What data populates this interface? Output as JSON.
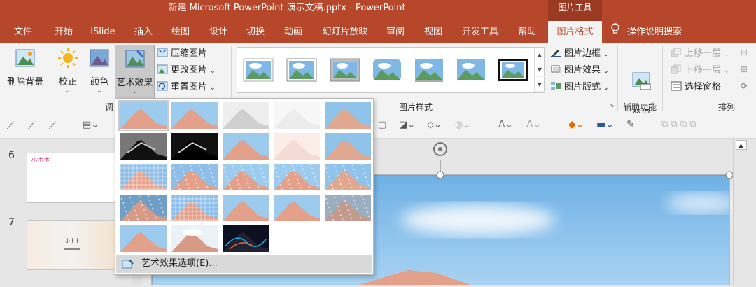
{
  "window": {
    "title": "新建 Microsoft PowerPoint 演示文稿.pptx  -  PowerPoint",
    "context_tab": "图片工具"
  },
  "tabs": [
    "文件",
    "开始",
    "iSlide",
    "插入",
    "绘图",
    "设计",
    "切换",
    "动画",
    "幻灯片放映",
    "审阅",
    "视图",
    "开发工具",
    "帮助",
    "图片格式"
  ],
  "active_tab": "图片格式",
  "search_label": "操作说明搜索",
  "ribbon": {
    "remove_bg": "删除背景",
    "correct": "校正",
    "color": "颜色",
    "artistic": "艺术效果",
    "compress": "压缩图片",
    "change": "更改图片",
    "reset": "重置图片",
    "adjust_label": "调",
    "styles_label": "图片样式",
    "border": "图片边框",
    "effects": "图片效果",
    "layout": "图片版式",
    "alt_text": "替换\n文字",
    "accessibility_label": "辅助功能",
    "bring_forward": "上移一层",
    "send_backward": "下移一层",
    "selection_pane": "选择窗格",
    "arrange_label": "排列"
  },
  "slides": [
    {
      "number": "6",
      "text": "小卞卞"
    },
    {
      "number": "7",
      "text": "小卞卞"
    }
  ],
  "dropdown": {
    "footer": "艺术效果选项(E)..."
  },
  "colors": {
    "accent": "#b7472a",
    "ribbon_bg": "#f3f3f3",
    "sky": "#7fb8e4",
    "mountain": "#e3a08a"
  }
}
